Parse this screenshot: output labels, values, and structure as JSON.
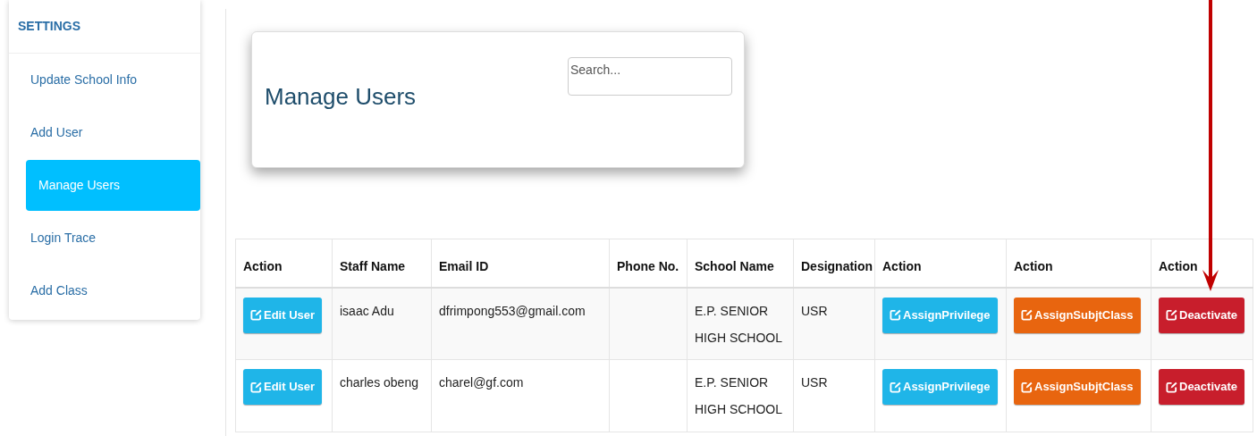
{
  "sidebar": {
    "title": "SETTINGS",
    "items": [
      {
        "label": "Update School Info",
        "selected": false
      },
      {
        "label": "Add User",
        "selected": false
      },
      {
        "label": "Manage Users",
        "selected": true
      },
      {
        "label": "Login Trace",
        "selected": false
      },
      {
        "label": "Add Class",
        "selected": false
      }
    ]
  },
  "header_card": {
    "title": "Manage Users",
    "search": {
      "placeholder": "Search..."
    }
  },
  "table": {
    "columns": [
      "Action",
      "Staff Name",
      "Email ID",
      "Phone No.",
      "School Name",
      "Designation",
      "Action",
      "Action",
      "Action"
    ],
    "rows": [
      {
        "cells": [
          {
            "kind": "button",
            "label": "Edit User",
            "color": "#1fb5e8"
          },
          {
            "kind": "text",
            "text": "isaac Adu"
          },
          {
            "kind": "text",
            "text": "dfrimpong553@gmail.com"
          },
          {
            "kind": "empty"
          },
          {
            "kind": "text",
            "text": "E.P. SENIOR HIGH SCHOOL"
          },
          {
            "kind": "text",
            "text": "USR"
          },
          {
            "kind": "button",
            "label": "AssignPrivilege",
            "color": "#1fb5e8"
          },
          {
            "kind": "button",
            "label": "AssignSubjtClass",
            "color": "#e8650f"
          },
          {
            "kind": "button",
            "label": "Deactivate",
            "color": "#c81e2c"
          }
        ]
      },
      {
        "cells": [
          {
            "kind": "button",
            "label": "Edit User",
            "color": "#1fb5e8"
          },
          {
            "kind": "text",
            "text": "charles obeng"
          },
          {
            "kind": "text",
            "text": "charel@gf.com"
          },
          {
            "kind": "empty"
          },
          {
            "kind": "text",
            "text": "E.P. SENIOR HIGH SCHOOL"
          },
          {
            "kind": "text",
            "text": "USR"
          },
          {
            "kind": "button",
            "label": "AssignPrivilege",
            "color": "#1fb5e8"
          },
          {
            "kind": "button",
            "label": "AssignSubjtClass",
            "color": "#e8650f"
          },
          {
            "kind": "button",
            "label": "Deactivate",
            "color": "#c81e2c"
          }
        ]
      }
    ]
  }
}
